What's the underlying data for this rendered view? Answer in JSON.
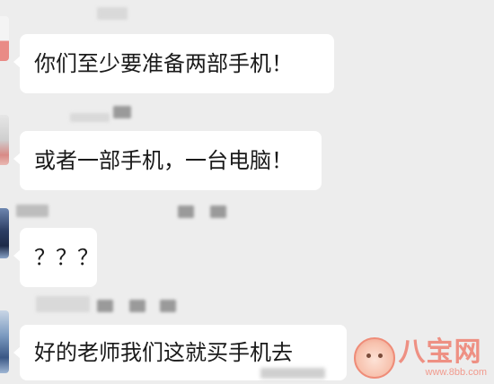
{
  "messages": [
    {
      "text": "你们至少要准备两部手机！"
    },
    {
      "text": "或者一部手机，一台电脑！"
    },
    {
      "text": "？？？"
    },
    {
      "text": "好的老师我们这就买手机去"
    }
  ],
  "watermark": {
    "brand": "八宝网",
    "site": "www.8bb.com",
    "icon": "baby-face-logo-icon"
  }
}
